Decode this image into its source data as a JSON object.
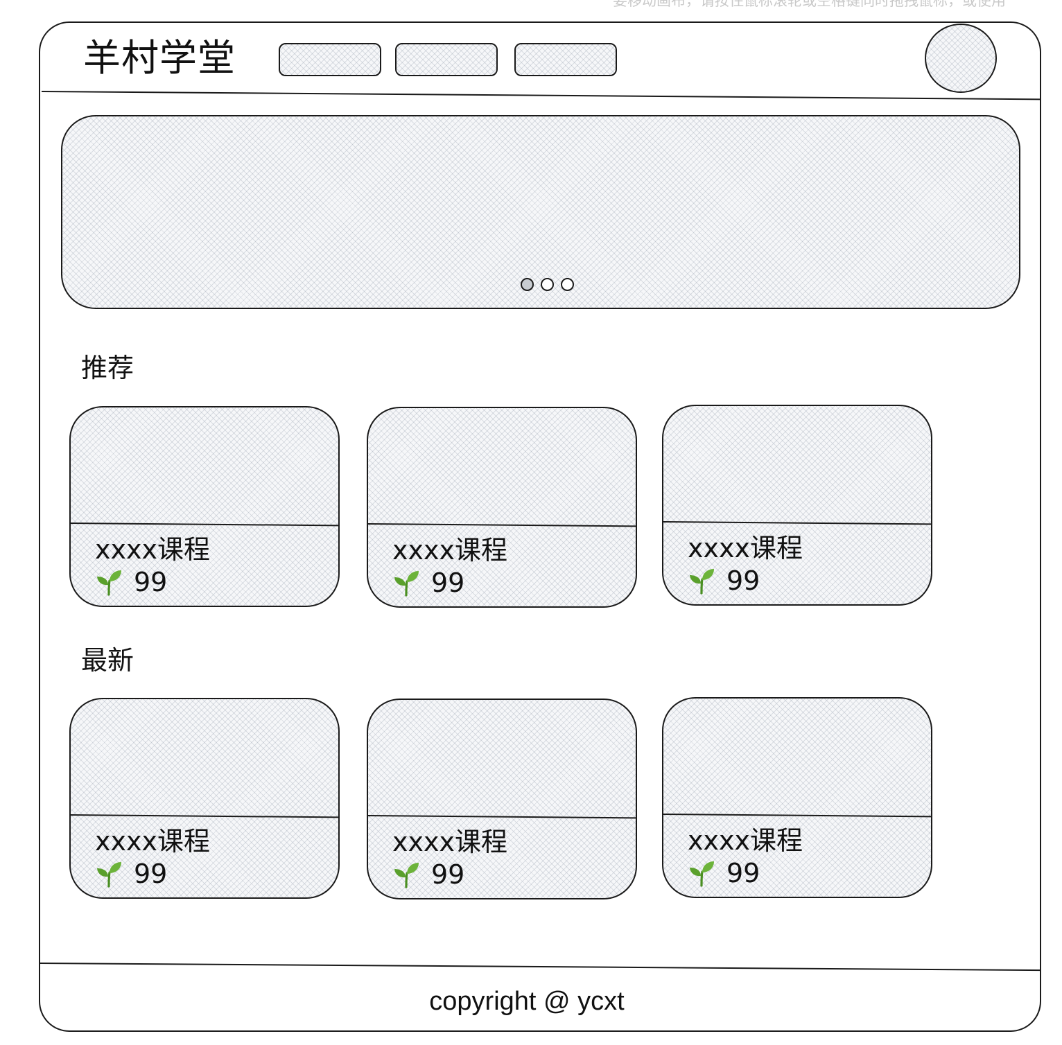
{
  "canvas_hint": "要移动画布，请按住鼠标滚轮或空格键同时拖拽鼠标，或使用",
  "header": {
    "logo": "羊村学堂",
    "nav_buttons": [
      {
        "label": ""
      },
      {
        "label": ""
      },
      {
        "label": ""
      }
    ]
  },
  "banner": {
    "slides": 3,
    "active_slide": 1
  },
  "sections": [
    {
      "title": "推荐",
      "courses": [
        {
          "title": "xxxx课程",
          "count": "99"
        },
        {
          "title": "xxxx课程",
          "count": "99"
        },
        {
          "title": "xxxx课程",
          "count": "99"
        }
      ]
    },
    {
      "title": "最新",
      "courses": [
        {
          "title": "xxxx课程",
          "count": "99"
        },
        {
          "title": "xxxx课程",
          "count": "99"
        },
        {
          "title": "xxxx课程",
          "count": "99"
        }
      ]
    }
  ],
  "icons": {
    "course_meta": "sprout-icon"
  },
  "colors": {
    "stroke": "#1a1a1a",
    "hatch_fill": "#f6f7f9",
    "sprout_green": "#5aa02c",
    "active_dot": "#c8ccd1"
  },
  "footer": {
    "text": "copyright @ ycxt"
  }
}
